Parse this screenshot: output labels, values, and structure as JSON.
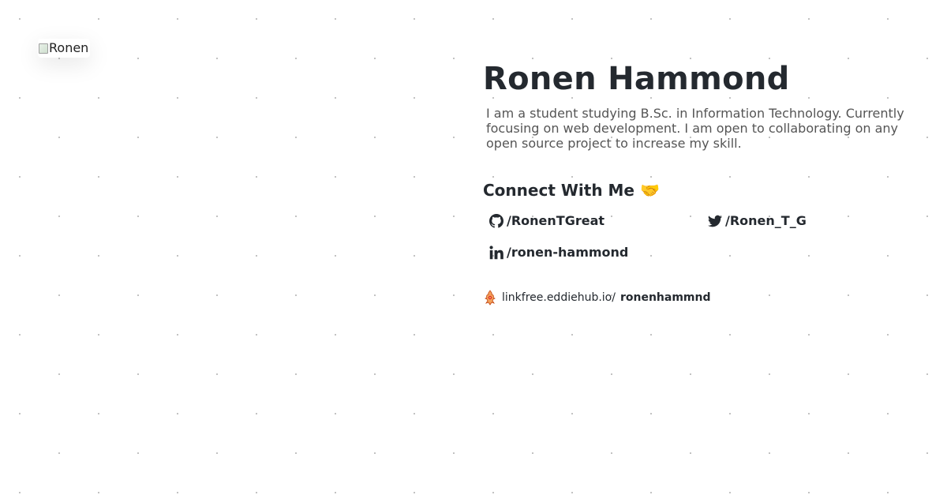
{
  "avatar": {
    "alt": "Ronen"
  },
  "profile": {
    "name": "Ronen Hammond",
    "bio": "I am a student studying B.Sc. in Information Technology. Currently focusing on web development. I am open to collaborating on any open source project to increase my skill."
  },
  "connect": {
    "heading": "Connect With Me 🤝",
    "links": [
      {
        "icon": "github-icon",
        "label": "/RonenTGreat"
      },
      {
        "icon": "twitter-icon",
        "label": "/Ronen_T_G"
      },
      {
        "icon": "linkedin-icon",
        "label": "/ronen-hammond"
      }
    ]
  },
  "linkfree": {
    "icon": "linkfree-logo-icon",
    "prefix": "linkfree.eddiehub.io/",
    "username": "ronenhammnd"
  },
  "colors": {
    "text": "#24292f",
    "muted": "#555555",
    "background": "#ffffff",
    "dot": "#bdbdbd"
  }
}
